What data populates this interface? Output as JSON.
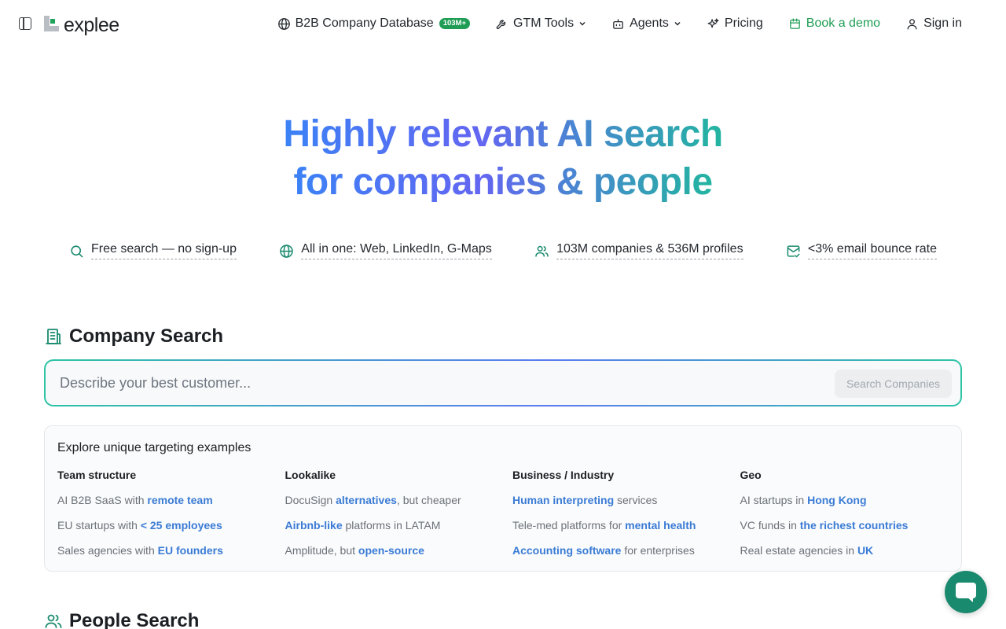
{
  "nav": {
    "logo_text": "explee",
    "items": [
      {
        "label": "B2B Company Database",
        "icon": "globe-icon",
        "badge": "103M+"
      },
      {
        "label": "GTM Tools",
        "icon": "wrench-icon",
        "dropdown": true
      },
      {
        "label": "Agents",
        "icon": "robot-icon",
        "dropdown": true
      },
      {
        "label": "Pricing",
        "icon": "sparkles-icon"
      },
      {
        "label": "Book a demo",
        "icon": "calendar-icon",
        "color": "#1f9d55"
      },
      {
        "label": "Sign in",
        "icon": "user-icon"
      }
    ]
  },
  "hero": {
    "line1": "Highly relevant AI search",
    "line2": "for companies & people"
  },
  "features": [
    {
      "label": "Free search — no sign-up",
      "icon": "search-icon"
    },
    {
      "label": "All in one: Web, LinkedIn, G-Maps",
      "icon": "globe-icon"
    },
    {
      "label": "103M companies & 536M profiles",
      "icon": "users-icon"
    },
    {
      "label": "<3% email bounce rate",
      "icon": "mail-check-icon"
    }
  ],
  "company_search": {
    "title": "Company Search",
    "placeholder": "Describe your best customer...",
    "button": "Search Companies"
  },
  "examples": {
    "title": "Explore unique targeting examples",
    "columns": [
      {
        "heading": "Team structure",
        "rows": [
          {
            "pre": "AI B2B SaaS with ",
            "hl": "remote team",
            "post": ""
          },
          {
            "pre": "EU startups with ",
            "hl": "< 25 employees",
            "post": ""
          },
          {
            "pre": "Sales agencies with ",
            "hl": "EU founders",
            "post": ""
          }
        ]
      },
      {
        "heading": "Lookalike",
        "rows": [
          {
            "pre": "DocuSign ",
            "hl": "alternatives",
            "post": ", but cheaper"
          },
          {
            "pre": "",
            "hl": "Airbnb-like",
            "post": " platforms in LATAM"
          },
          {
            "pre": "Amplitude, but ",
            "hl": "open-source",
            "post": ""
          }
        ]
      },
      {
        "heading": "Business / Industry",
        "rows": [
          {
            "pre": "",
            "hl": "Human interpreting",
            "post": " services"
          },
          {
            "pre": "Tele-med platforms for ",
            "hl": "mental health",
            "post": ""
          },
          {
            "pre": "",
            "hl": "Accounting software",
            "post": " for enterprises"
          }
        ]
      },
      {
        "heading": "Geo",
        "rows": [
          {
            "pre": "AI startups in ",
            "hl": "Hong Kong",
            "post": ""
          },
          {
            "pre": "VC funds in ",
            "hl": "the richest countries",
            "post": ""
          },
          {
            "pre": "Real estate agencies in ",
            "hl": "UK",
            "post": ""
          }
        ]
      }
    ]
  },
  "people_search": {
    "title": "People Search"
  },
  "colors": {
    "brand_green": "#1f9d55",
    "link_blue": "#3a7bd5",
    "gradient": [
      "#3b82f6",
      "#6366f1",
      "#22b5a0"
    ]
  }
}
